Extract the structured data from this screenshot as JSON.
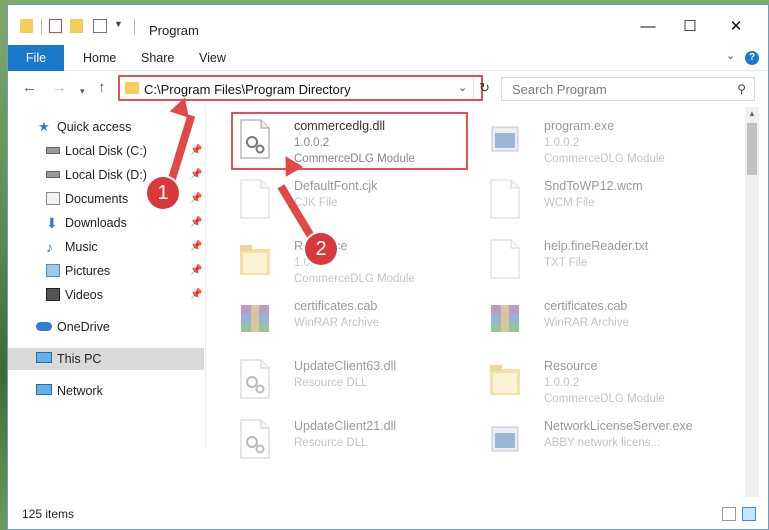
{
  "titlebar": {
    "title": "Program",
    "minimize": "—",
    "maximize": "☐",
    "close": "✕"
  },
  "ribbon": {
    "file": "File",
    "home": "Home",
    "share": "Share",
    "view": "View",
    "help": "?"
  },
  "nav": {
    "address": "C:\\Program Files\\Program Directory",
    "search_placeholder": "Search Program"
  },
  "sidebar": {
    "items": [
      {
        "label": "Quick access",
        "icon": "star-icon"
      },
      {
        "label": "Local Disk (C:)",
        "icon": "drive-icon"
      },
      {
        "label": "Local Disk (D:)",
        "icon": "drive-icon"
      },
      {
        "label": "Documents",
        "icon": "documents-icon"
      },
      {
        "label": "Downloads",
        "icon": "download-icon"
      },
      {
        "label": "Music",
        "icon": "music-icon"
      },
      {
        "label": "Pictures",
        "icon": "pictures-icon"
      },
      {
        "label": "Videos",
        "icon": "videos-icon"
      },
      {
        "label": "OneDrive",
        "icon": "cloud-icon"
      },
      {
        "label": "This PC",
        "icon": "computer-icon"
      },
      {
        "label": "Network",
        "icon": "network-icon"
      }
    ]
  },
  "files": [
    {
      "name": "commercedlg.dll",
      "sub1": "1.0.0.2",
      "sub2": "CommerceDLG Module",
      "icon": "dll-icon"
    },
    {
      "name": "program.exe",
      "sub1": "1.0.0.2",
      "sub2": "CommerceDLG Module",
      "icon": "exe-icon"
    },
    {
      "name": "DefaultFont.cjk",
      "sub1": "CJK File",
      "sub2": "",
      "icon": "file-icon"
    },
    {
      "name": "SndToWP12.wcm",
      "sub1": "WCM File",
      "sub2": "",
      "icon": "file-icon"
    },
    {
      "name": "Resource",
      "sub1": "1.0.0.2",
      "sub2": "CommerceDLG Module",
      "icon": "folder-icon"
    },
    {
      "name": "help.fineReader.txt",
      "sub1": "TXT File",
      "sub2": "",
      "icon": "file-icon"
    },
    {
      "name": "certificates.cab",
      "sub1": "WinRAR Archive",
      "sub2": "",
      "icon": "winrar-icon"
    },
    {
      "name": "certificates.cab",
      "sub1": "WinRAR Archive",
      "sub2": "",
      "icon": "winrar-icon"
    },
    {
      "name": "UpdateClient63.dll",
      "sub1": "Resource DLL",
      "sub2": "",
      "icon": "dll-icon"
    },
    {
      "name": "Resource",
      "sub1": "1.0.0.2",
      "sub2": "CommerceDLG Module",
      "icon": "folder-icon"
    },
    {
      "name": "UpdateClient21.dll",
      "sub1": "Resource DLL",
      "sub2": "",
      "icon": "dll-icon"
    },
    {
      "name": "NetworkLicenseServer.exe",
      "sub1": "ABBY network licens...",
      "sub2": "",
      "icon": "exe-icon"
    }
  ],
  "status": {
    "items": "125 items"
  },
  "callouts": {
    "one": "1",
    "two": "2"
  },
  "colors": {
    "accent": "#1979ca",
    "highlight": "#e45151"
  }
}
